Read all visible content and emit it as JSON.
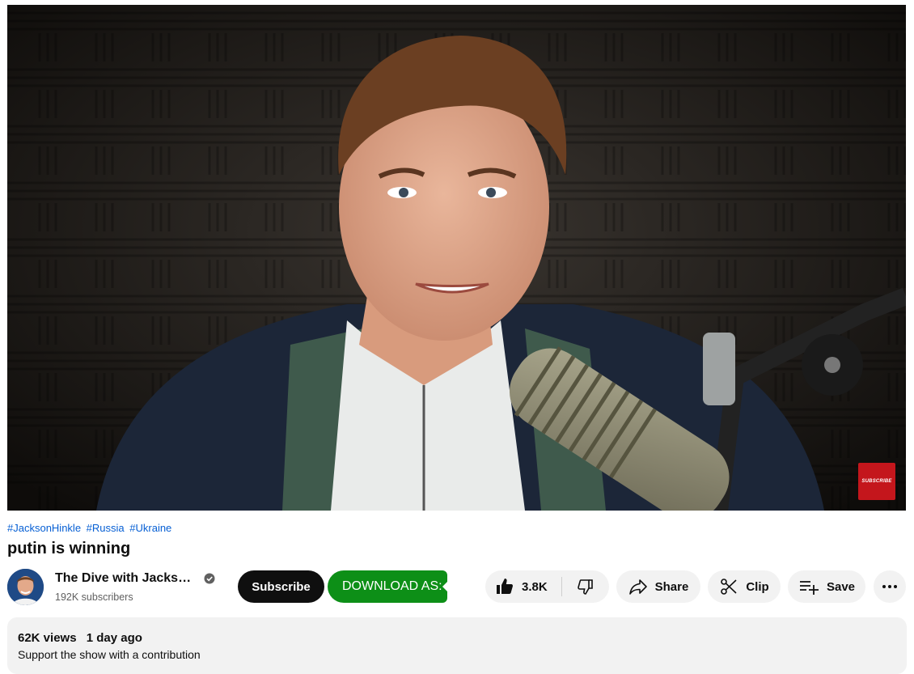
{
  "player": {
    "watermark_label": "SUBSCRIBE"
  },
  "video": {
    "hashtags": [
      "#JacksonHinkle",
      "#Russia",
      "#Ukraine"
    ],
    "title": "putin is winning"
  },
  "channel": {
    "name": "The Dive with Jacks…",
    "subscribers": "192K subscribers",
    "verified_icon": "check-circle-icon"
  },
  "actions": {
    "subscribe_label": "Subscribe",
    "download_label": "DOWNLOAD AS:",
    "like_count": "3.8K",
    "share_label": "Share",
    "clip_label": "Clip",
    "save_label": "Save",
    "more_icon": "more-horizontal-icon"
  },
  "description": {
    "views": "62K views",
    "age": "1 day ago",
    "first_line": "Support the show with a contribution"
  },
  "colors": {
    "link": "#065fd4",
    "subscribe_bg": "#0f0f0f",
    "download_bg": "#0d8f17",
    "pill_bg": "#f2f2f2",
    "watermark_red": "#c4161c"
  }
}
